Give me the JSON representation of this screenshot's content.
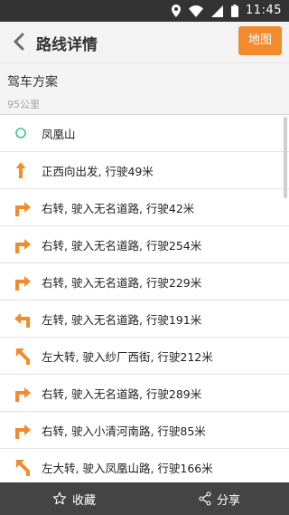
{
  "status_bar": {
    "time": "11:45"
  },
  "header": {
    "title": "路线详情",
    "map_button": "地图"
  },
  "plan": {
    "title": "驾车方案",
    "distance": "95公里"
  },
  "steps": [
    {
      "icon": "start-circle-icon",
      "text": "凤凰山"
    },
    {
      "icon": "straight-arrow-icon",
      "text": "正西向出发, 行驶49米"
    },
    {
      "icon": "turn-right-icon",
      "text": "右转, 驶入无名道路, 行驶42米"
    },
    {
      "icon": "turn-right-icon",
      "text": "右转, 驶入无名道路, 行驶254米"
    },
    {
      "icon": "turn-right-icon",
      "text": "右转, 驶入无名道路, 行驶229米"
    },
    {
      "icon": "turn-left-icon",
      "text": "左转, 驶入无名道路, 行驶191米"
    },
    {
      "icon": "sharp-left-icon",
      "text": "左大转, 驶入纱厂西街, 行驶212米"
    },
    {
      "icon": "turn-right-icon",
      "text": "右转, 驶入无名道路, 行驶289米"
    },
    {
      "icon": "turn-right-icon",
      "text": "右转, 驶入小清河南路, 行驶85米"
    },
    {
      "icon": "sharp-left-icon",
      "text": "左大转, 驶入凤凰山路, 行驶166米"
    }
  ],
  "bottom_bar": {
    "favorite_label": "收藏",
    "share_label": "分享"
  },
  "colors": {
    "accent": "#f28a2e",
    "start_marker": "#3fbf8f"
  }
}
